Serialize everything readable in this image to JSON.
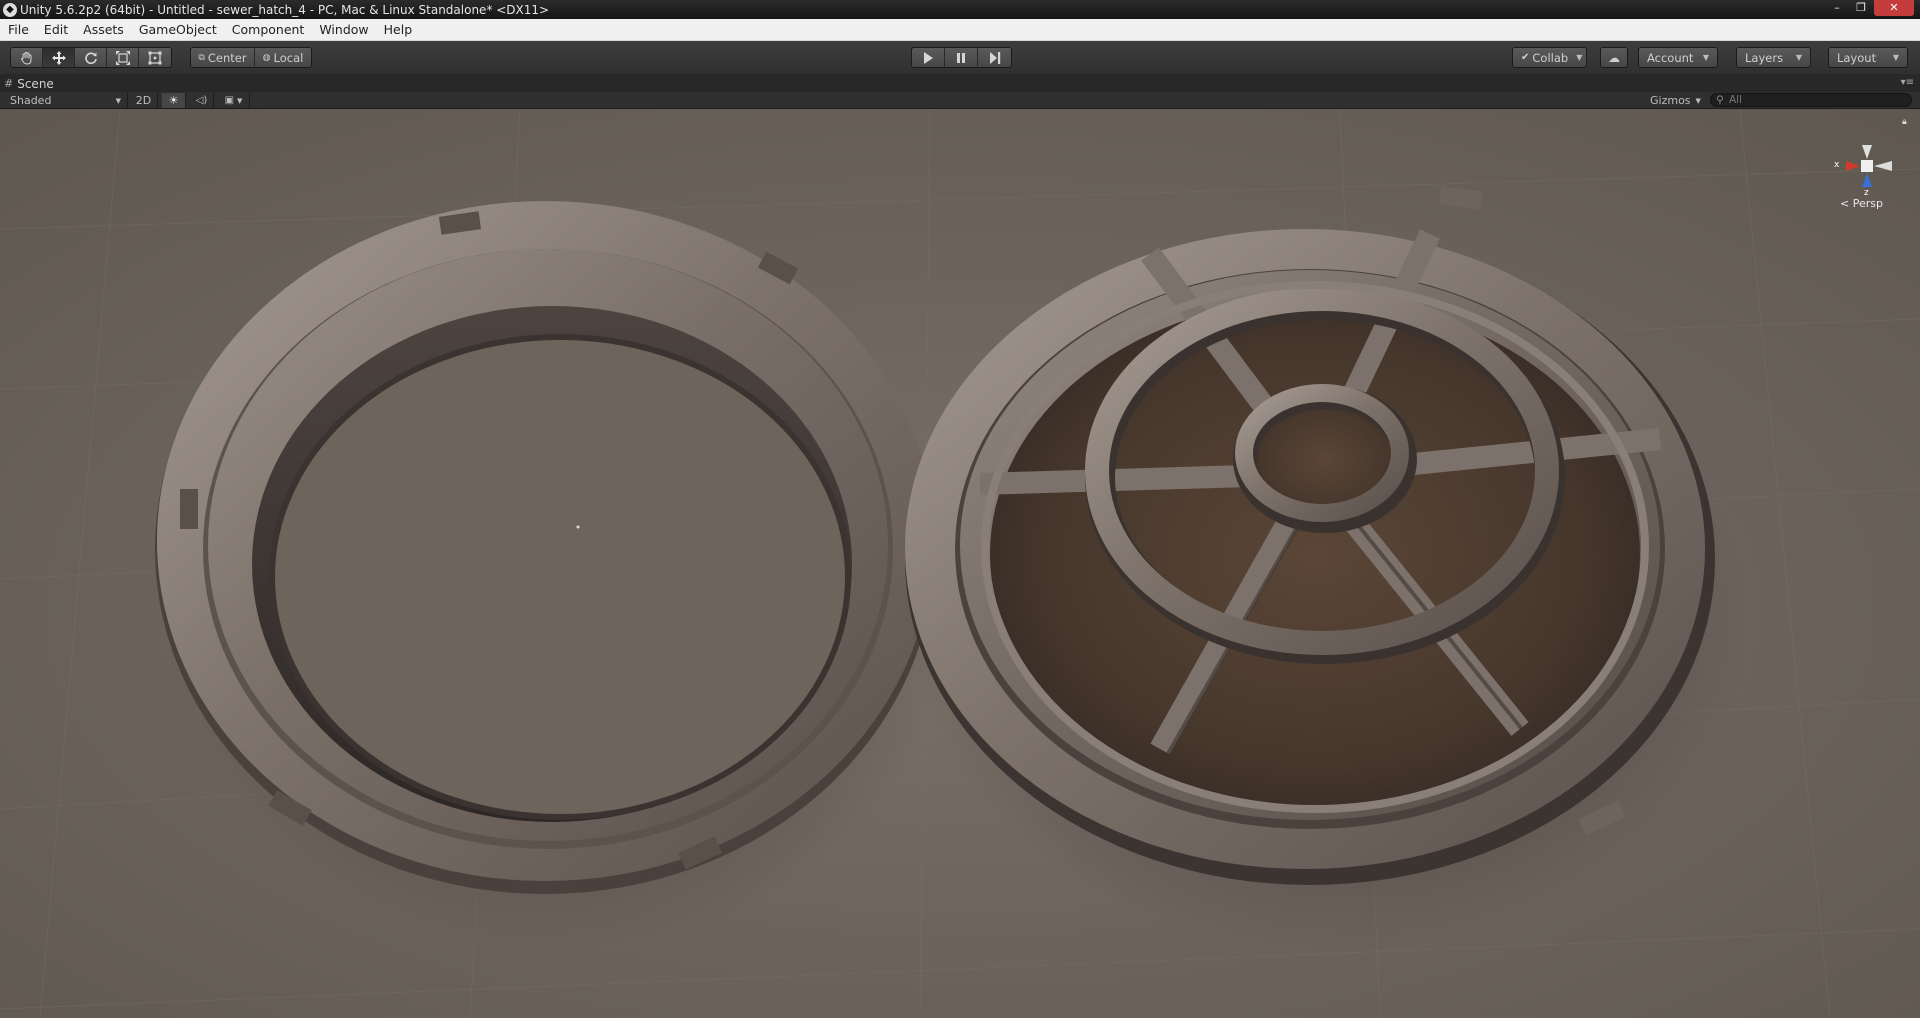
{
  "window": {
    "title": "Unity 5.6.2p2 (64bit) - Untitled - sewer_hatch_4 - PC, Mac & Linux Standalone* <DX11>",
    "controls": {
      "minimize": "–",
      "maximize": "❐",
      "close": "✕"
    }
  },
  "menu": {
    "items": [
      {
        "label": "File"
      },
      {
        "label": "Edit"
      },
      {
        "label": "Assets"
      },
      {
        "label": "GameObject"
      },
      {
        "label": "Component"
      },
      {
        "label": "Window"
      },
      {
        "label": "Help"
      }
    ]
  },
  "toolbar": {
    "tools": [
      "hand",
      "move",
      "rotate",
      "scale",
      "rect"
    ],
    "active_tool": "move",
    "pivot_mode": "Center",
    "pivot_rotation": "Local",
    "collab": "Collab",
    "account": "Account",
    "layers": "Layers",
    "layout": "Layout"
  },
  "scene": {
    "tab_label": "Scene",
    "shading_mode": "Shaded",
    "mode_2d": "2D",
    "gizmos": "Gizmos",
    "search_placeholder": "All",
    "projection": "Persp",
    "axis_labels": {
      "x": "x",
      "z": "z"
    }
  },
  "colors": {
    "scene_background": "#6d655c",
    "axis_x": "#d23b2a",
    "axis_y": "#e0e0e0",
    "axis_z": "#3b6fd6",
    "metal_light": "#9a8e86",
    "metal_dark": "#3a3330",
    "rust": "#5a4332"
  }
}
